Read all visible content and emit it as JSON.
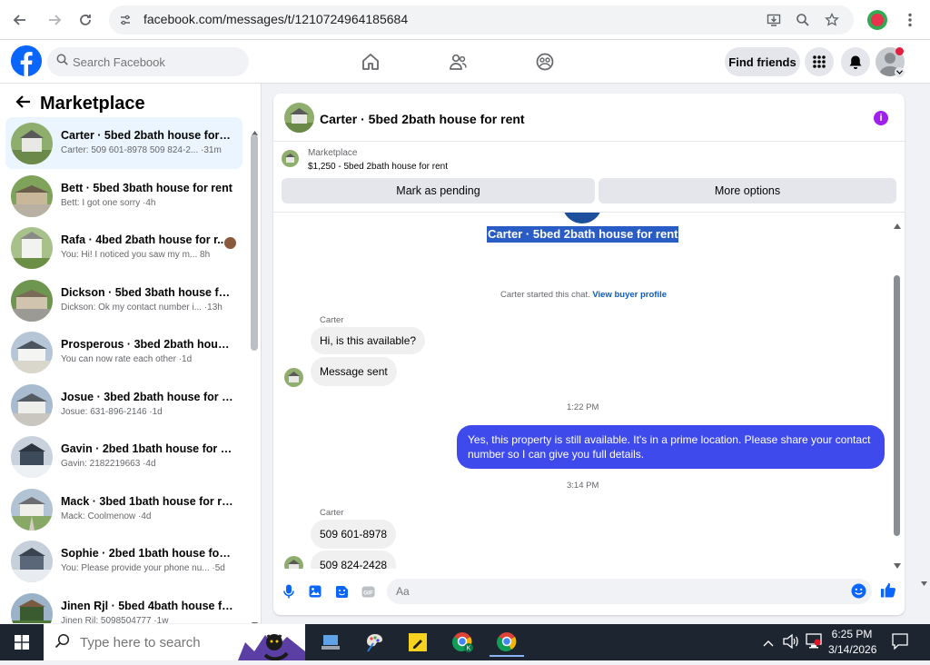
{
  "browser": {
    "url": "facebook.com/messages/t/1210724964185684"
  },
  "fb_nav": {
    "search_placeholder": "Search Facebook",
    "find_friends_label": "Find friends"
  },
  "sidebar": {
    "title": "Marketplace",
    "conversations": [
      {
        "title": "Carter · 5bed 2bath house for r...",
        "preview": "Carter: 509 601-8978 509 824-2... ·31m",
        "active": true
      },
      {
        "title": "Bett · 5bed 3bath house for rent",
        "preview": "Bett: I got one sorry ·4h"
      },
      {
        "title": "Rafa · 4bed 2bath house for r...",
        "preview": "You: Hi! I noticed you saw my m... 8h"
      },
      {
        "title": "Dickson · 5bed 3bath house for ...",
        "preview": "Dickson: Ok my contact number i... ·13h"
      },
      {
        "title": "Prosperous · 3bed 2bath house ...",
        "preview": "You can now rate each other ·1d"
      },
      {
        "title": "Josue · 3bed 2bath house for rent",
        "preview": "Josue: 631-896-2146 ·1d"
      },
      {
        "title": "Gavin · 2bed 1bath house for rent",
        "preview": "Gavin: 2182219663 ·4d"
      },
      {
        "title": "Mack · 3bed 1bath house for rent",
        "preview": "Mack: Coolmenow ·4d"
      },
      {
        "title": "Sophie · 2bed 1bath house for r...",
        "preview": "You: Please provide your phone nu... ·5d"
      },
      {
        "title": "Jinen Rjl · 5bed 4bath house for...",
        "preview": "Jinen Rjl: 5098504777 ·1w"
      }
    ]
  },
  "chat": {
    "header_title": "Carter · 5bed 2bath house for rent",
    "listing": {
      "source": "Marketplace",
      "price_title": "$1,250 - 5bed 2bath house for rent",
      "mark_pending_label": "Mark as pending",
      "more_options_label": "More options"
    },
    "thread_title": "Carter · 5bed 2bath house for rent",
    "started_text": "Carter started this chat.",
    "view_profile_label": "View buyer profile",
    "sender_name_1": "Carter",
    "msg_in_1": "Hi, is this available?",
    "msg_in_2": "Message sent",
    "time_1": "1:22 PM",
    "msg_out_1": "Yes, this property is still available. It's in a prime location. Please share your contact number so I can give you full details.",
    "time_2": "3:14 PM",
    "sender_name_2": "Carter",
    "msg_in_3": "509 601-8978",
    "msg_in_4": "509 824-2428",
    "composer_placeholder": "Aa"
  },
  "taskbar": {
    "search_placeholder": "Type here to search",
    "time": "6:25 PM",
    "date": "3/14/2026"
  },
  "colors": {
    "fb_blue": "#0866ff",
    "outgoing_bubble": "#3e4aeb",
    "messenger_accent": "#a020f0"
  }
}
